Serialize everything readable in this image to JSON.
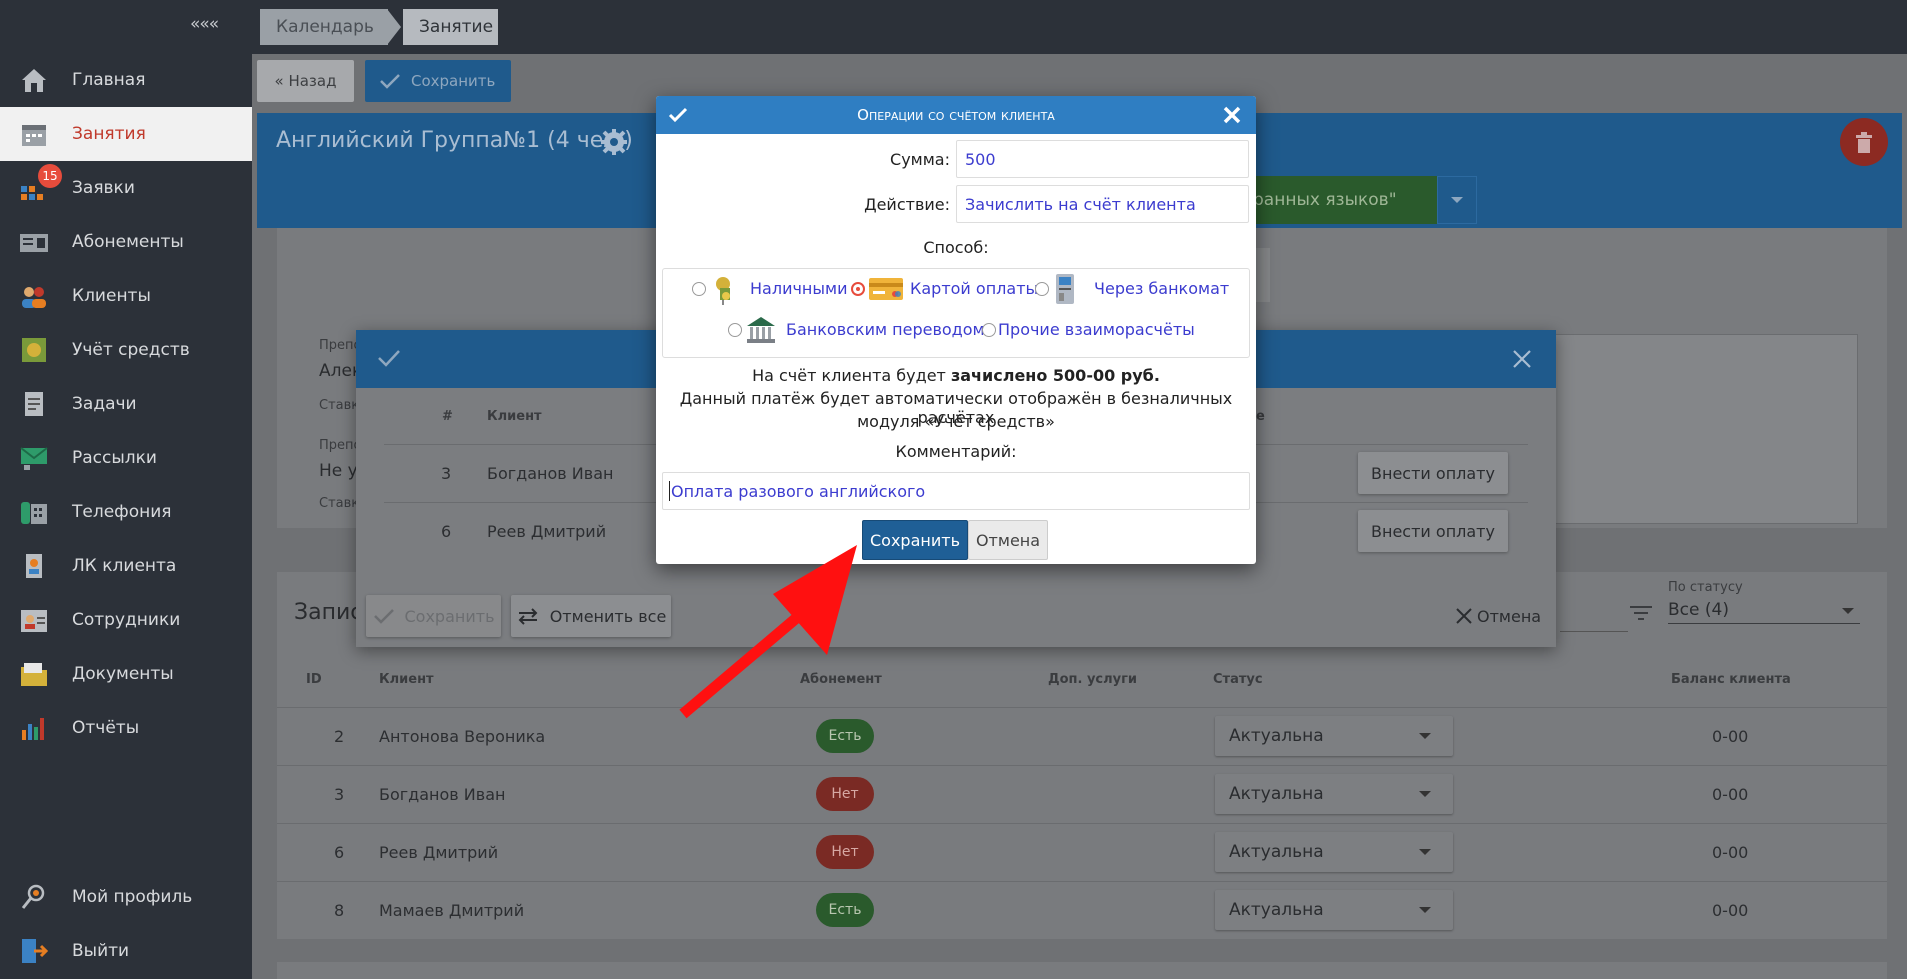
{
  "sidebar": {
    "collapse": "«««",
    "items": [
      {
        "label": "Главная",
        "icon": "home-icon"
      },
      {
        "label": "Занятия",
        "icon": "calendar-icon"
      },
      {
        "label": "Заявки",
        "icon": "requests-icon",
        "badge": "15"
      },
      {
        "label": "Абонементы",
        "icon": "subscription-icon"
      },
      {
        "label": "Клиенты",
        "icon": "clients-icon"
      },
      {
        "label": "Учёт средств",
        "icon": "finance-icon"
      },
      {
        "label": "Задачи",
        "icon": "tasks-icon"
      },
      {
        "label": "Рассылки",
        "icon": "mailing-icon"
      },
      {
        "label": "Телефония",
        "icon": "phone-icon"
      },
      {
        "label": "ЛК клиента",
        "icon": "client-account-icon"
      },
      {
        "label": "Сотрудники",
        "icon": "staff-icon"
      },
      {
        "label": "Документы",
        "icon": "documents-icon"
      },
      {
        "label": "Отчёты",
        "icon": "reports-icon"
      }
    ],
    "bottom": [
      {
        "label": "Мой профиль",
        "icon": "profile-icon"
      },
      {
        "label": "Выйти",
        "icon": "logout-icon"
      }
    ]
  },
  "breadcrumbs": [
    "Календарь",
    "Занятие"
  ],
  "toolbar": {
    "back": "« Назад",
    "save": "Сохранить"
  },
  "lesson": {
    "title": "Английский Группа№1 (4 чел.)",
    "program_fragment": "ранных языков\""
  },
  "background_fields": {
    "teacher_label": "Препо",
    "teacher_value": "Алек",
    "rate_label": "Ставк",
    "teacher2_label": "Препо",
    "teacher2_value": "Не у",
    "rate2_label": "Ставк"
  },
  "records_fragment": "Запис",
  "filter": {
    "label": "По статусу",
    "value": "Все (4)"
  },
  "table": {
    "headers": [
      "ID",
      "Клиент",
      "Абонемент",
      "Доп. услуги",
      "Статус",
      "Баланс клиента"
    ],
    "rows": [
      {
        "id": "2",
        "client": "Антонова Вероника",
        "sub": "Есть",
        "status": "Актуальна",
        "balance": "0-00"
      },
      {
        "id": "3",
        "client": "Богданов Иван",
        "sub": "Нет",
        "status": "Актуальна",
        "balance": "0-00"
      },
      {
        "id": "6",
        "client": "Реев Дмитрий",
        "sub": "Нет",
        "status": "Актуальна",
        "balance": "0-00"
      },
      {
        "id": "8",
        "client": "Мамаев Дмитрий",
        "sub": "Есть",
        "status": "Актуальна",
        "balance": "0-00"
      }
    ]
  },
  "mid_modal": {
    "headers": [
      "#",
      "Клиент"
    ],
    "header_e": "е",
    "rows": [
      {
        "num": "3",
        "client": "Богданов Иван",
        "action": "Внести оплату"
      },
      {
        "num": "6",
        "client": "Реев Дмитрий",
        "action": "Внести оплату"
      }
    ],
    "save": "Сохранить",
    "cancel_all": "Отменить все",
    "cancel": "Отмена"
  },
  "dialog": {
    "title": "Операции со счётом клиента",
    "amount_label": "Сумма:",
    "amount_value": "500",
    "action_label": "Действие:",
    "action_value": "Зачислить на счёт клиента",
    "method_label": "Способ:",
    "methods": [
      "Наличными",
      "Картой оплаты",
      "Через банкомат",
      "Банковским переводом",
      "Прочие взаиморасчёты"
    ],
    "info_prefix": "На счёт клиента будет ",
    "info_bold": "зачислено 500-00 руб.",
    "info_line2": "Данный платёж будет автоматически отображён в безналичных расчётах",
    "info_line3": "модуля «Учёт средств»",
    "comment_label": "Комментарий:",
    "comment_value": "Оплата разового английского",
    "save": "Сохранить",
    "cancel": "Отмена"
  }
}
